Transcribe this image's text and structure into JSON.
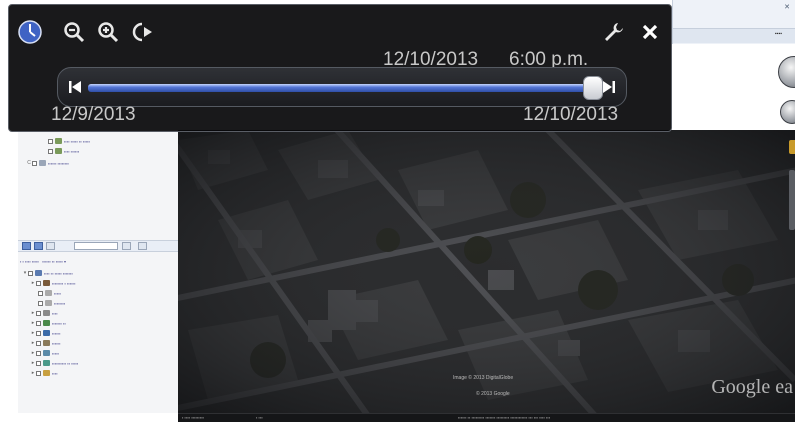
{
  "time_slider": {
    "current_date": "12/10/2013",
    "current_time": "6:00 p.m.",
    "start_date": "12/9/2013",
    "end_date": "12/10/2013",
    "position_fraction": 0.99,
    "accent_color": "#3f63c4"
  },
  "toolbar_icons": [
    "clock-icon",
    "zoom-out-icon",
    "zoom-in-icon",
    "animation-play-icon",
    "settings-wrench-icon",
    "close-icon"
  ],
  "map": {
    "watermark": "Google ea",
    "imagery_credit": "Image © 2013 DigitalGlobe",
    "copyright": "© 2013 Google"
  }
}
